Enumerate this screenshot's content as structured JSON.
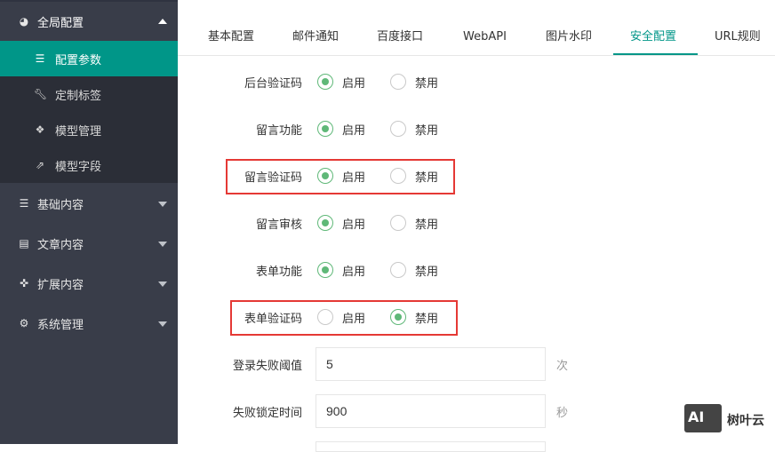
{
  "sidebar": {
    "top_label": "全局配置",
    "sub_items": [
      {
        "label": "配置参数",
        "icon": "sliders-icon"
      },
      {
        "label": "定制标签",
        "icon": "wrench-icon"
      },
      {
        "label": "模型管理",
        "icon": "cube-icon"
      },
      {
        "label": "模型字段",
        "icon": "external-link-icon"
      }
    ],
    "groups": [
      {
        "label": "基础内容",
        "icon": "sliders-icon"
      },
      {
        "label": "文章内容",
        "icon": "document-icon"
      },
      {
        "label": "扩展内容",
        "icon": "puzzle-icon"
      },
      {
        "label": "系统管理",
        "icon": "gear-icon"
      }
    ]
  },
  "tabs": [
    "基本配置",
    "邮件通知",
    "百度接口",
    "WebAPI",
    "图片水印",
    "安全配置",
    "URL规则"
  ],
  "active_tab": "安全配置",
  "options": {
    "enable": "启用",
    "disable": "禁用"
  },
  "rows": [
    {
      "label": "后台验证码",
      "selected": "enable"
    },
    {
      "label": "留言功能",
      "selected": "enable"
    },
    {
      "label": "留言验证码",
      "selected": "enable",
      "highlighted": true
    },
    {
      "label": "留言审核",
      "selected": "enable"
    },
    {
      "label": "表单功能",
      "selected": "enable"
    },
    {
      "label": "表单验证码",
      "selected": "disable",
      "highlighted": true
    }
  ],
  "fields": [
    {
      "label": "登录失败阈值",
      "value": "5",
      "unit": "次"
    },
    {
      "label": "失败锁定时间",
      "value": "900",
      "unit": "秒"
    }
  ],
  "watermark": {
    "logo_text": "AI",
    "name": "树叶云"
  },
  "colors": {
    "accent": "#009688",
    "radio_on": "#5fb878",
    "highlight": "#e53935",
    "sidebar": "#393d49"
  }
}
